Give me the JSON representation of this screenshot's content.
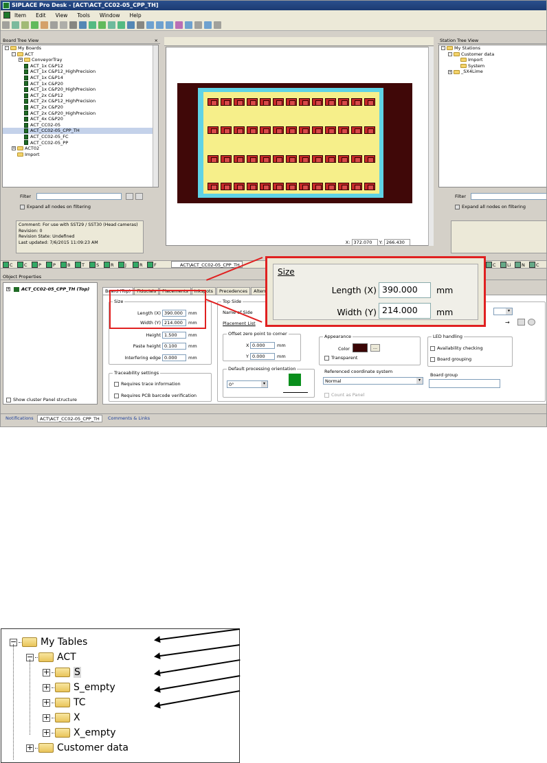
{
  "window": {
    "title": "SIPLACE Pro Desk - [ACT\\ACT_CC02-05_CPP_TH]"
  },
  "menu": [
    "Item",
    "Edit",
    "View",
    "Tools",
    "Window",
    "Help"
  ],
  "board_tree": {
    "header": "Board Tree View",
    "header_controls": " ×",
    "items": [
      {
        "label": "My Boards",
        "level": 0,
        "kind": "folder",
        "exp": "-"
      },
      {
        "label": "ACT",
        "level": 1,
        "kind": "folder",
        "exp": "-"
      },
      {
        "label": "ConveyorTray",
        "level": 2,
        "kind": "folder",
        "exp": "+"
      },
      {
        "label": "ACT_1x C&P12",
        "level": 2,
        "kind": "board"
      },
      {
        "label": "ACT_1x C&P12_HighPrecision",
        "level": 2,
        "kind": "board"
      },
      {
        "label": "ACT_1x C&P14",
        "level": 2,
        "kind": "board"
      },
      {
        "label": "ACT_1x C&P20",
        "level": 2,
        "kind": "board"
      },
      {
        "label": "ACT_1x C&P20_HighPrecision",
        "level": 2,
        "kind": "board"
      },
      {
        "label": "ACT_2x C&P12",
        "level": 2,
        "kind": "board"
      },
      {
        "label": "ACT_2x C&P12_HighPrecision",
        "level": 2,
        "kind": "board"
      },
      {
        "label": "ACT_2x C&P20",
        "level": 2,
        "kind": "board"
      },
      {
        "label": "ACT_2x C&P20_HighPrecision",
        "level": 2,
        "kind": "board"
      },
      {
        "label": "ACT_4x C&P20",
        "level": 2,
        "kind": "board"
      },
      {
        "label": "ACT_CC02-05",
        "level": 2,
        "kind": "board"
      },
      {
        "label": "ACT_CC02-05_CPP_TH",
        "level": 2,
        "kind": "board",
        "selected": true
      },
      {
        "label": "ACT_CC02-05_FC",
        "level": 2,
        "kind": "board"
      },
      {
        "label": "ACT_CC02-05_PP",
        "level": 2,
        "kind": "board"
      },
      {
        "label": "ACT02",
        "level": 1,
        "kind": "folder",
        "exp": "+"
      },
      {
        "label": "Import",
        "level": 1,
        "kind": "folder"
      }
    ],
    "filter_label": "Filter",
    "expand_label": "Expand all nodes on filtering",
    "info": [
      "Comment: For use with SST29 / SST30 (Head cameras)",
      "Revision: 0",
      "Revision State: Undefined",
      "Last updated: 7/6/2015 11:09:23 AM"
    ]
  },
  "station_tree": {
    "header": "Station Tree View",
    "items": [
      {
        "label": "My Stations",
        "level": 0,
        "exp": "-"
      },
      {
        "label": "Customer data",
        "level": 1,
        "exp": "-"
      },
      {
        "label": "Import",
        "level": 2
      },
      {
        "label": "System",
        "level": 2
      },
      {
        "label": "_SX4Lime",
        "level": 1,
        "exp": "+"
      }
    ],
    "filter_label": "Filter",
    "expand_label": "Expand all nodes on filtering"
  },
  "canvas": {
    "coord_x_label": "X:",
    "coord_x": "372.070",
    "coord_y_label": "Y:",
    "coord_y": "266.430",
    "tab_label": "ACT\\ACT_CC02-05_CPP_TH",
    "board_color": "#400808",
    "panel_color": "#5fd3e6",
    "pcb_color": "#f6ef8a"
  },
  "bottom_tabs_left": [
    "C",
    "C",
    "P",
    "P",
    "B",
    "T",
    "S",
    "R",
    "J",
    "R",
    "F"
  ],
  "bottom_tabs_right": [
    "C",
    "Li",
    "N",
    "C"
  ],
  "object_properties": {
    "header": "Object Properties",
    "tree_item": "ACT_CC02-05_CPP_TH (Top)",
    "show_cluster": "Show cluster Panel structure",
    "tabs": [
      "Board (Top)",
      "Fiducials",
      "Placements",
      "Inkspots",
      "Precedences",
      "Alternat"
    ],
    "size_group": "Size",
    "length_label": "Length (X)",
    "length_value": "390.000",
    "width_label": "Width (Y)",
    "width_value": "214.000",
    "height_label": "Height",
    "height_value": "1.500",
    "paste_label": "Paste height",
    "paste_value": "0.100",
    "interfering_label": "Interfering edge",
    "interfering_value": "0.000",
    "unit": "mm",
    "traceability_group": "Traceability settings",
    "trace_info": "Requires trace information",
    "pcb_barcode": "Requires PCB barcode verification",
    "topside_group": "Top Side",
    "name_of_side": "Name of Side",
    "placement_list": "Placement List",
    "offset_group": "Offset zero point to corner",
    "x_label": "X",
    "x_value": "0.000",
    "y_label": "Y",
    "y_value": "0.000",
    "default_orient_group": "Default processing orientation",
    "orient_value": "0°",
    "appearance_group": "Appearance",
    "color_label": "Color",
    "color_value": "#3b0606",
    "ellipsis": "...",
    "transparent": "Transparent",
    "ref_coord_group": "Referenced coordinate system",
    "ref_coord_value": "Normal",
    "count_as_panel": "Count as Panel",
    "led_group": "LED handling",
    "availability": "Availability checking",
    "board_grouping": "Board grouping",
    "board_group": "Board group"
  },
  "status_tabs": [
    "Notifications",
    "ACT\\ACT_CC02-05_CPP_TH",
    "Comments & Links"
  ],
  "zoom": {
    "title": "Size",
    "length_label": "Length (X)",
    "length_value": "390.000",
    "width_label": "Width (Y)",
    "width_value": "214.000",
    "unit": "mm"
  },
  "tables_tree": {
    "items": [
      {
        "label": "My Tables",
        "exp": "−",
        "level": 0
      },
      {
        "label": "ACT",
        "exp": "−",
        "level": 1
      },
      {
        "label": "S",
        "exp": "+",
        "level": 2,
        "arrow": true
      },
      {
        "label": "S_empty",
        "exp": "+",
        "level": 2,
        "arrow": true
      },
      {
        "label": "TC",
        "exp": "+",
        "level": 2,
        "arrow": true
      },
      {
        "label": "X",
        "exp": "+",
        "level": 2,
        "arrow": true
      },
      {
        "label": "X_empty",
        "exp": "+",
        "level": 2,
        "arrow": true
      },
      {
        "label": "Customer data",
        "exp": "+",
        "level": 1
      }
    ]
  }
}
